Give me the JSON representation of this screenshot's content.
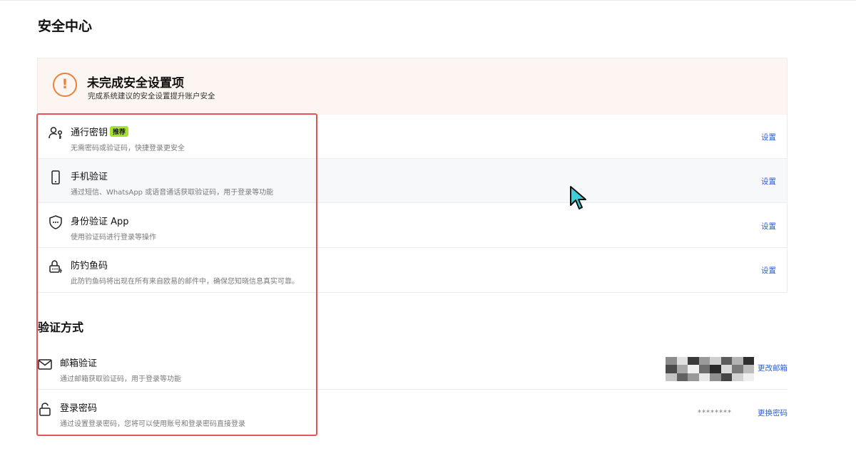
{
  "page": {
    "title": "安全中心"
  },
  "warning": {
    "title": "未完成安全设置项",
    "subtitle": "完成系统建议的安全设置提升账户安全",
    "icon": "exclamation-circle-icon",
    "color": "#e8823a"
  },
  "security_items": [
    {
      "icon": "passkey-icon",
      "title": "通行密钥",
      "badge": "推荐",
      "desc": "无需密码或验证码，快捷登录更安全",
      "action": "设置"
    },
    {
      "icon": "phone-icon",
      "title": "手机验证",
      "desc": "通过短信、WhatsApp 或语音通话获取验证码，用于登录等功能",
      "action": "设置"
    },
    {
      "icon": "shield-icon",
      "title": "身份验证 App",
      "desc": "使用验证码进行登录等操作",
      "action": "设置"
    },
    {
      "icon": "anti-phishing-icon",
      "title": "防钓鱼码",
      "desc": "此防钓鱼码将出现在所有来自欧易的邮件中，确保您知晓信息真实可靠。",
      "action": "设置"
    }
  ],
  "verification": {
    "section_title": "验证方式",
    "items": [
      {
        "icon": "mail-icon",
        "title": "邮箱验证",
        "desc": "通过邮箱获取验证码，用于登录等功能",
        "action": "更改邮箱"
      },
      {
        "icon": "lock-icon",
        "title": "登录密码",
        "desc": "通过设置登录密码，您将可以使用账号和登录密码直接登录",
        "masked_value": "********",
        "action": "更换密码"
      }
    ]
  },
  "colors": {
    "link": "#2a5bd7",
    "badge": "#a6e22e",
    "highlight_border": "#e25555",
    "banner_bg": "#fcf5f1"
  }
}
